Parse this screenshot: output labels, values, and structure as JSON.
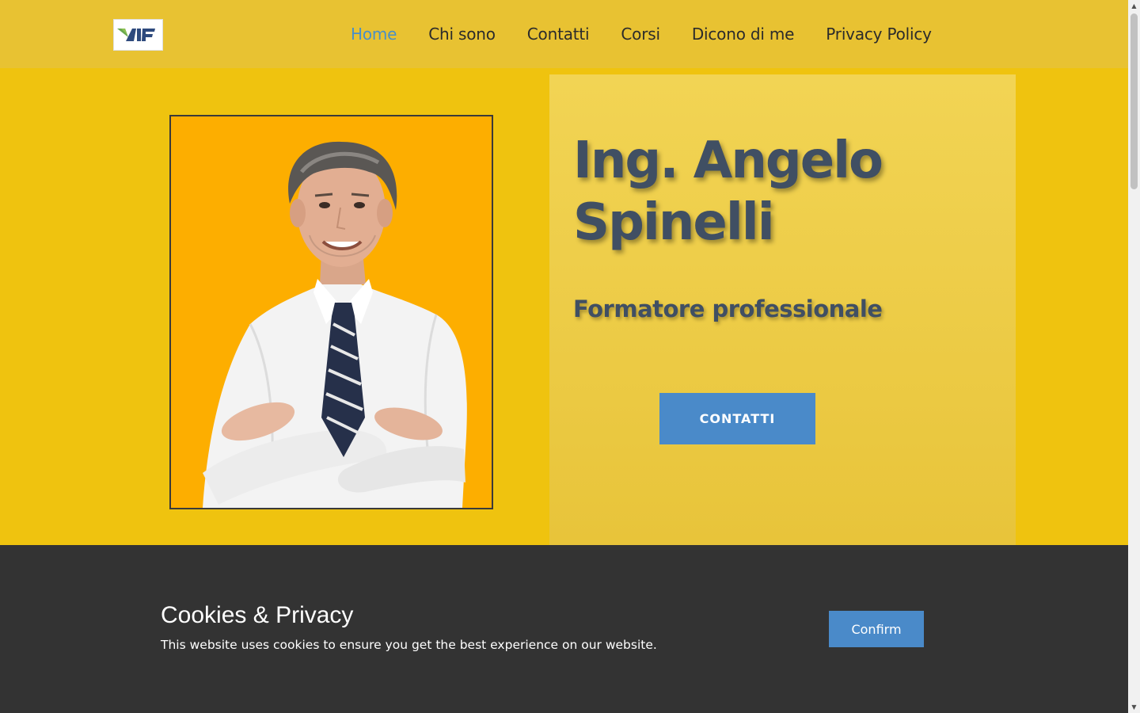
{
  "header": {
    "logo_text": "AIF",
    "nav": [
      {
        "label": "Home",
        "active": true
      },
      {
        "label": "Chi sono",
        "active": false
      },
      {
        "label": "Contatti",
        "active": false
      },
      {
        "label": "Corsi",
        "active": false
      },
      {
        "label": "Dicono di me",
        "active": false
      },
      {
        "label": "Privacy Policy",
        "active": false
      }
    ]
  },
  "hero": {
    "title": "Ing. Angelo Spinelli",
    "subtitle": "Formatore professionale",
    "cta_label": "CONTATTI"
  },
  "cookie": {
    "title": "Cookies & Privacy",
    "text": "This website uses cookies to ensure you get the best experience on our website.",
    "confirm_label": "Confirm"
  },
  "colors": {
    "header_bg": "#e8c232",
    "hero_bg": "#efc30f",
    "photo_bg": "#fdae00",
    "accent_blue": "#4a8ac9",
    "title_text": "#404f63",
    "cookie_bg": "#333333"
  },
  "icons": {
    "logo": "aif-logo",
    "scroll_up": "chevron-up-icon",
    "scroll_down": "chevron-down-icon"
  }
}
